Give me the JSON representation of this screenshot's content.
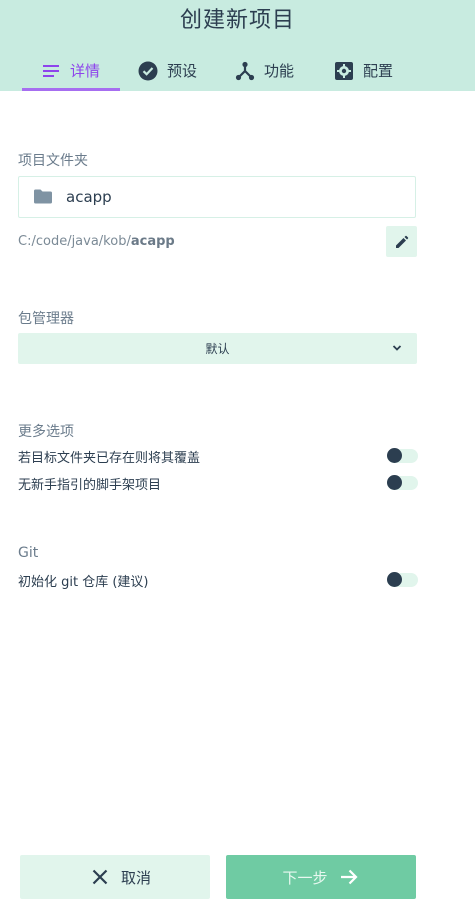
{
  "header": {
    "title": "创建新项目",
    "tabs": [
      {
        "label": "详情",
        "icon": "list-icon",
        "active": true
      },
      {
        "label": "预设",
        "icon": "check-circle-icon",
        "active": false
      },
      {
        "label": "功能",
        "icon": "fork-icon",
        "active": false
      },
      {
        "label": "配置",
        "icon": "settings-icon",
        "active": false
      }
    ]
  },
  "folder": {
    "section_label": "项目文件夹",
    "name": "acapp",
    "path_prefix": "C:/code/java/kob/",
    "path_bold": "acapp"
  },
  "package_manager": {
    "section_label": "包管理器",
    "selected": "默认"
  },
  "more_options": {
    "section_label": "更多选项",
    "options": [
      {
        "label": "若目标文件夹已存在则将其覆盖",
        "enabled": false
      },
      {
        "label": "无新手指引的脚手架项目",
        "enabled": false
      }
    ]
  },
  "git": {
    "section_label": "Git",
    "option_label": "初始化 git 仓库 (建议)",
    "enabled": false
  },
  "footer": {
    "cancel_label": "取消",
    "next_label": "下一步"
  },
  "colors": {
    "header_bg": "#c8ebe0",
    "active_tab": "#8e44ec",
    "accent_light": "#e1f5ec",
    "primary_button": "#6fcba3",
    "text_dark": "#2c3e50"
  }
}
